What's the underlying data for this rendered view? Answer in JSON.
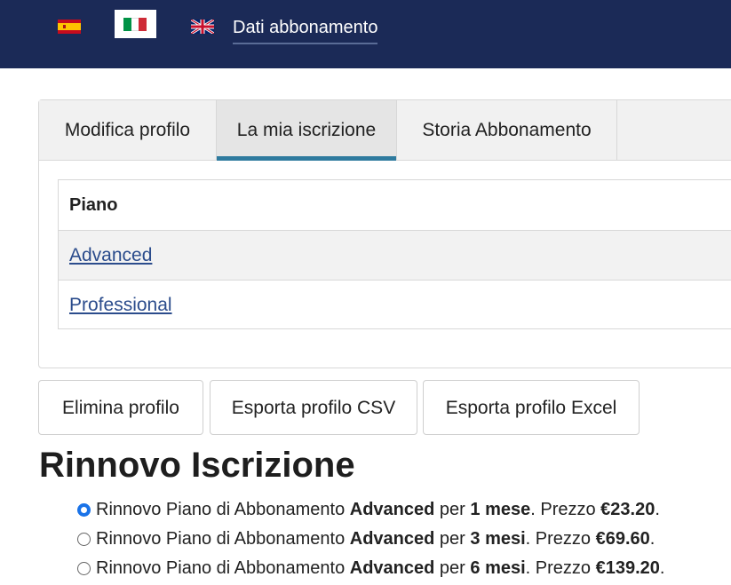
{
  "header": {
    "title": "Dati abbonamento",
    "languages": [
      {
        "code": "es",
        "icon": "spain-flag-icon"
      },
      {
        "code": "it",
        "icon": "italy-flag-icon",
        "selected": true
      },
      {
        "code": "en",
        "icon": "uk-flag-icon"
      }
    ],
    "background_color": "#1b2a57"
  },
  "tabs": [
    {
      "label": "Modifica profilo"
    },
    {
      "label": "La mia iscrizione",
      "active": true
    },
    {
      "label": "Storia Abbonamento"
    }
  ],
  "plan_table": {
    "header": "Piano",
    "rows": [
      {
        "label": "Advanced"
      },
      {
        "label": "Professional"
      }
    ]
  },
  "actions": {
    "delete_label": "Elimina profilo",
    "export_csv_label": "Esporta profilo CSV",
    "export_excel_label": "Esporta profilo Excel"
  },
  "renewal": {
    "title": "Rinnovo Iscrizione",
    "options": [
      {
        "prefix": "Rinnovo Piano di Abbonamento ",
        "plan": "Advanced",
        "per": " per ",
        "duration": "1 mese",
        "price_label": ". Prezzo ",
        "price": "€23.20",
        "end": ".",
        "checked": true
      },
      {
        "prefix": "Rinnovo Piano di Abbonamento ",
        "plan": "Advanced",
        "per": " per ",
        "duration": "3 mesi",
        "price_label": ". Prezzo ",
        "price": "€69.60",
        "end": ".",
        "checked": false
      },
      {
        "prefix": "Rinnovo Piano di Abbonamento ",
        "plan": "Advanced",
        "per": " per ",
        "duration": "6 mesi",
        "price_label": ". Prezzo ",
        "price": "€139.20",
        "end": ".",
        "checked": false
      }
    ]
  },
  "accent_color": "#2e7a9e"
}
